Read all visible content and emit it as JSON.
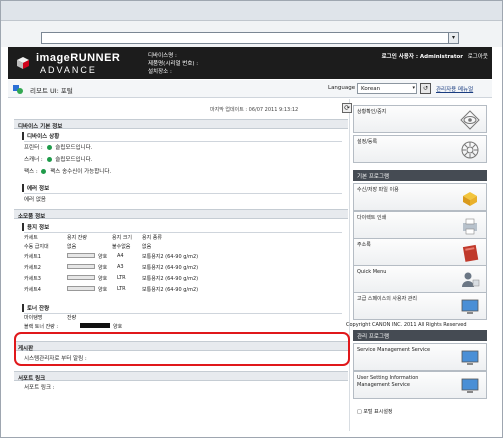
{
  "header": {
    "brand_line1": "imageRUNNER",
    "brand_line2": "ADVANCE",
    "device_name_label": "디바이스명 :",
    "product_name_label": "제품명(시리얼 번호) :",
    "location_label": "설치장소 :",
    "login_user": "로그인 사용자 : Administrator",
    "logout": "로그아웃"
  },
  "titlebar": {
    "title": "리모트 UI: 포털",
    "language_label": "Language",
    "language_value": "Korean",
    "manual_link": "관리자용 메뉴얼"
  },
  "main": {
    "last_updated": "마지막 업데이트 : 06/07 2011 9:13:12",
    "device_info_header": "디바이스 기본 정보",
    "device_status_header": "디바이스 상황",
    "printer_label": "프린터 :",
    "printer_status": "슬립모드입니다.",
    "scanner_label": "스캐너 :",
    "scanner_status": "슬립모드입니다.",
    "fax_label": "팩스 :",
    "fax_status": "팩스 송수신이 가능합니다.",
    "error_header": "에러 정보",
    "error_value": "에러 없음",
    "consumables_header": "소모품 정보",
    "paper_header": "용지 정보",
    "paper_cols": [
      "카세트",
      "용지 잔량",
      "용지 크기",
      "용지 종류"
    ],
    "paper_rows": [
      {
        "name": "수동 급지대",
        "level": "없음",
        "size": "불수없음",
        "type": "없음"
      },
      {
        "name": "카세트1",
        "level": "양호",
        "size": "A4",
        "type": "보통용지2 (64-90 g/m2)"
      },
      {
        "name": "카세트2",
        "level": "양호",
        "size": "A3",
        "type": "보통용지2 (64-90 g/m2)"
      },
      {
        "name": "카세트3",
        "level": "양호",
        "size": "LTR",
        "type": "보통용지2 (64-90 g/m2)"
      },
      {
        "name": "카세트4",
        "level": "양호",
        "size": "LTR",
        "type": "보통용지2 (64-90 g/m2)"
      }
    ],
    "toner_header": "토너 잔량",
    "toner_cols": [
      "마이탱명",
      "잔량"
    ],
    "toner_row_name": "블랙 토너 잔량 :",
    "toner_row_status": "양호",
    "board_header": "게시판",
    "board_text": "시스템관리자로 부터 알림 :",
    "support_header": "서포트 링크",
    "support_text": "서포트 링크 :"
  },
  "sidebar": {
    "btn_status": "상황확인/중지",
    "btn_settings": "설정/등록",
    "basic_section": "기본 프로그램",
    "btn_rx": "수신/저장 파일 이용",
    "btn_direct_print": "다이렉트 인쇄",
    "btn_addressbook": "주소록",
    "btn_quick_menu": "Quick Menu",
    "btn_scan_user": "고급 스페이스의 사용자 관리",
    "admin_section": "관리 프로그램",
    "btn_sms": "Service Management Service",
    "btn_usim": "User Setting Information Management Service",
    "portal_display": "포털 표시설정",
    "copyright": "Copyright CANON INC. 2011 All Rights Reserved"
  }
}
